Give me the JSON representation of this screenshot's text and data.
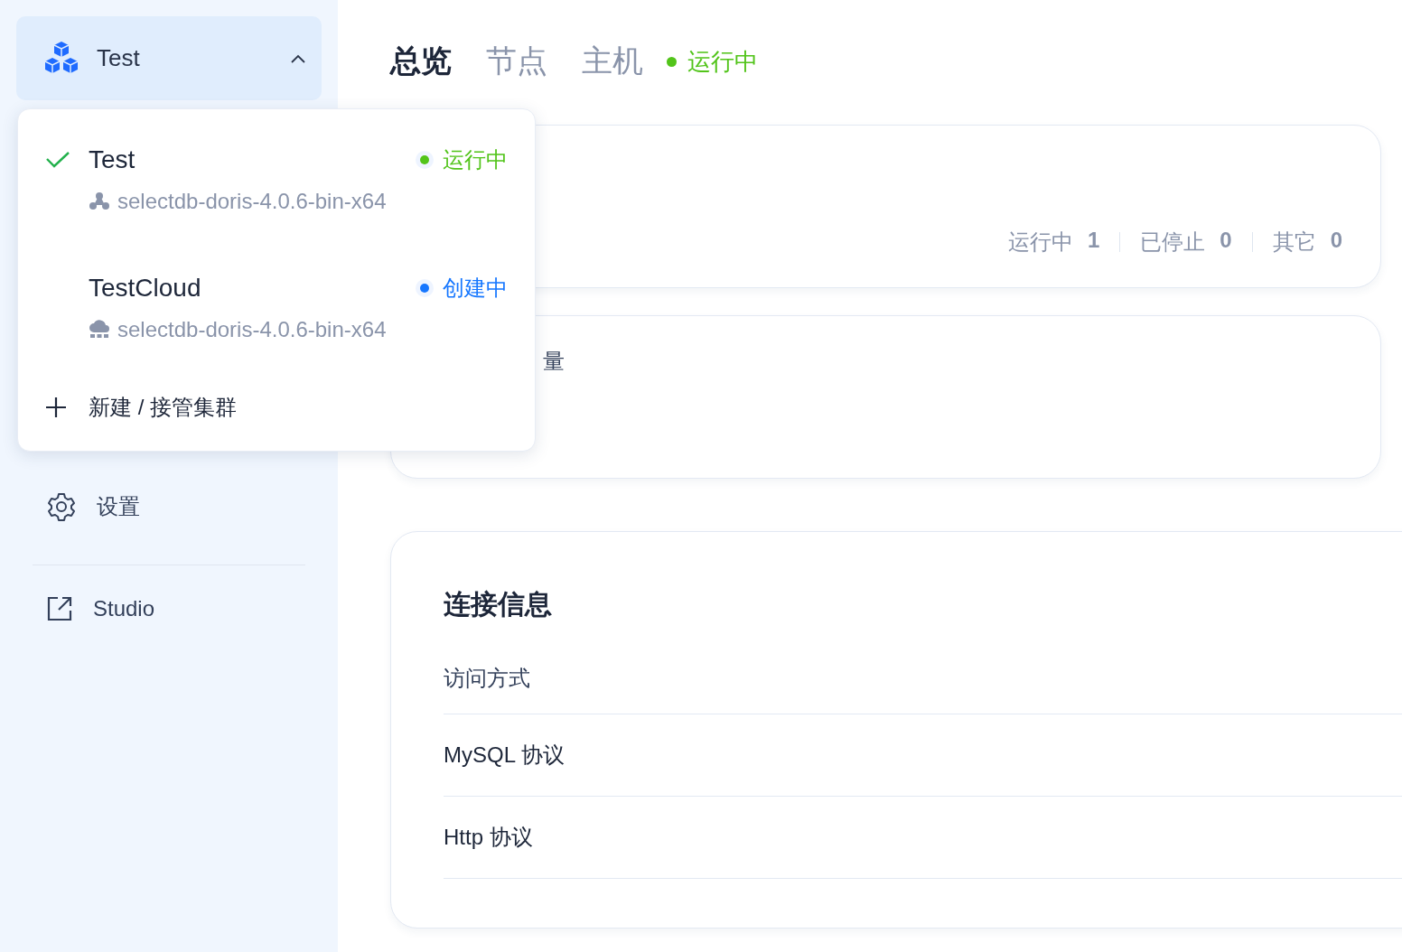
{
  "sidebar": {
    "cluster_selector": {
      "name": "Test",
      "expanded": true
    },
    "items": [
      {
        "label": "设置",
        "kind": "settings"
      },
      {
        "label": "Studio",
        "kind": "external"
      }
    ]
  },
  "dropdown": {
    "clusters": [
      {
        "name": "Test",
        "selected": true,
        "kind": "local",
        "status": "运行中",
        "color": "#52c41a",
        "version": "selectdb-doris-4.0.6-bin-x64"
      },
      {
        "name": "TestCloud",
        "selected": false,
        "kind": "cloud",
        "status": "创建中",
        "color": "#1677ff",
        "version": "selectdb-doris-4.0.6-bin-x64"
      }
    ],
    "add_label": "新建 / 接管集群"
  },
  "tabs": [
    {
      "label": "总览",
      "selected": true
    },
    {
      "label": "节点",
      "selected": false
    },
    {
      "label": "主机",
      "selected": false
    }
  ],
  "cluster_status": {
    "label": "运行中",
    "color": "#52c41a"
  },
  "summary_card": {
    "stats": [
      {
        "label": "运行中",
        "value": "1"
      },
      {
        "label": "已停止",
        "value": "0"
      },
      {
        "label": "其它",
        "value": "0"
      }
    ]
  },
  "count_card": {
    "title": "量"
  },
  "connection": {
    "title": "连接信息",
    "rows": [
      {
        "label": "访问方式",
        "kind": "header"
      },
      {
        "label": "MySQL 协议",
        "kind": "item"
      },
      {
        "label": "Http 协议",
        "kind": "item"
      }
    ]
  }
}
